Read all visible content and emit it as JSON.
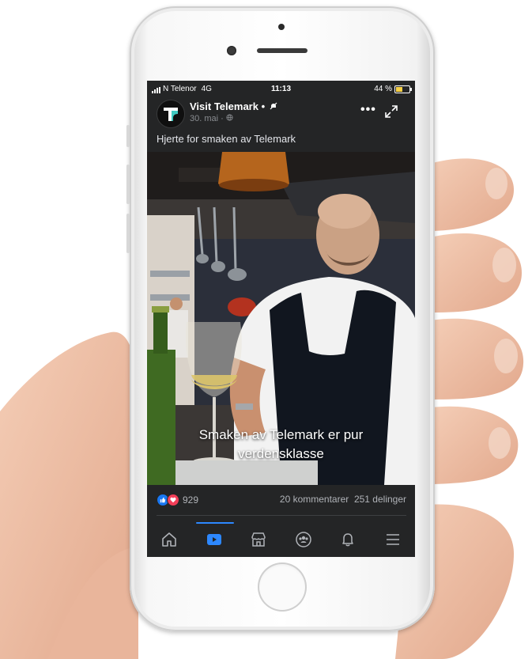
{
  "status_bar": {
    "carrier": "N Telenor",
    "network": "4G",
    "time": "11:13",
    "battery": "44 %"
  },
  "post": {
    "page_name": "Visit Telemark",
    "page_suffix": " •",
    "date": "30. mai · ",
    "caption": "Hjerte for smaken av Telemark",
    "more_label": "•••"
  },
  "video": {
    "subtitle_line1": "Smaken av Telemark er pur",
    "subtitle_line2": "verdensklasse"
  },
  "engagement": {
    "reaction_count": "929",
    "comments_shares": "20 kommentarer  251 delinger"
  },
  "nav": {
    "items": [
      "home-icon",
      "watch-icon",
      "marketplace-icon",
      "groups-icon",
      "notifications-icon",
      "menu-icon"
    ],
    "active": "watch-icon"
  },
  "colors": {
    "accent": "#2d88ff",
    "like": "#1877f2",
    "love": "#f33e58",
    "screen_bg": "#242526"
  }
}
